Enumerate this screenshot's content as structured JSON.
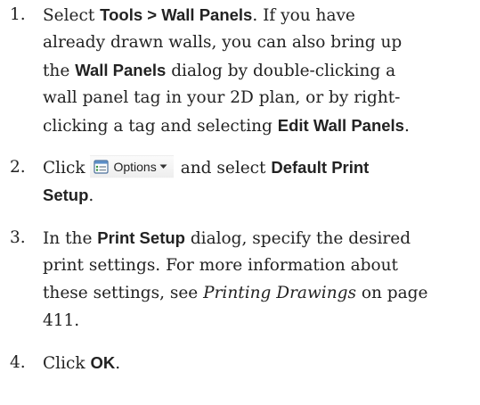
{
  "steps": [
    {
      "number": "1.",
      "lines": [
        [
          {
            "t": "Select "
          },
          {
            "t": "Tools > Wall Panels",
            "b": true
          },
          {
            "t": ". If you have"
          }
        ],
        [
          {
            "t": "already drawn walls, you can also bring up"
          }
        ],
        [
          {
            "t": "the "
          },
          {
            "t": "Wall Panels",
            "b": true
          },
          {
            "t": " dialog by double-clicking a"
          }
        ],
        [
          {
            "t": "wall panel tag in your 2D plan, or by right-"
          }
        ],
        [
          {
            "t": "clicking a tag and selecting "
          },
          {
            "t": "Edit Wall Panels",
            "b": true
          },
          {
            "t": "."
          }
        ]
      ]
    },
    {
      "number": "2.",
      "lines": [
        [
          {
            "t": "Click "
          },
          {
            "button": "Options"
          },
          {
            "t": "and select "
          },
          {
            "t": "Default Print",
            "b": true
          }
        ],
        [
          {
            "t": "Setup",
            "b": true
          },
          {
            "t": "."
          }
        ]
      ]
    },
    {
      "number": "3.",
      "lines": [
        [
          {
            "t": "In the "
          },
          {
            "t": "Print Setup",
            "b": true
          },
          {
            "t": " dialog, specify the desired"
          }
        ],
        [
          {
            "t": "print settings. For more information about"
          }
        ],
        [
          {
            "t": "these settings, see "
          },
          {
            "t": "Printing Drawings",
            "i": true
          },
          {
            "t": " on page"
          }
        ],
        [
          {
            "t": "411."
          }
        ]
      ]
    },
    {
      "number": "4.",
      "lines": [
        [
          {
            "t": "Click "
          },
          {
            "t": "OK",
            "b": true
          },
          {
            "t": "."
          }
        ]
      ]
    }
  ],
  "options_button": {
    "label": "Options",
    "icon": "options-icon",
    "accent": "#2f8f3a"
  }
}
